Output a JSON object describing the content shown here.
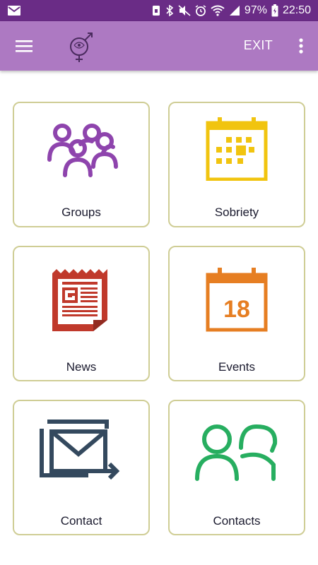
{
  "status_bar": {
    "battery": "97%",
    "time": "22:50"
  },
  "app_bar": {
    "exit_label": "EXIT",
    "icons": [
      "menu-icon",
      "logo-icon",
      "more-vert-icon"
    ]
  },
  "tiles": [
    {
      "label": "Groups",
      "icon": "groups-icon",
      "color": "#8e44ad"
    },
    {
      "label": "Sobriety",
      "icon": "calendar-grid-icon",
      "color": "#f1c40f"
    },
    {
      "label": "News",
      "icon": "newspaper-icon",
      "color": "#c0392b"
    },
    {
      "label": "Events",
      "icon": "calendar-date-icon",
      "color": "#e67e22",
      "date": "18"
    },
    {
      "label": "Contact",
      "icon": "mail-forward-icon",
      "color": "#34495e"
    },
    {
      "label": "Contacts",
      "icon": "contacts-icon",
      "color": "#27ae60"
    }
  ],
  "colors": {
    "status_bar": "#6a2c86",
    "app_bar": "#ad79c2",
    "tile_border": "#cfcd95"
  }
}
